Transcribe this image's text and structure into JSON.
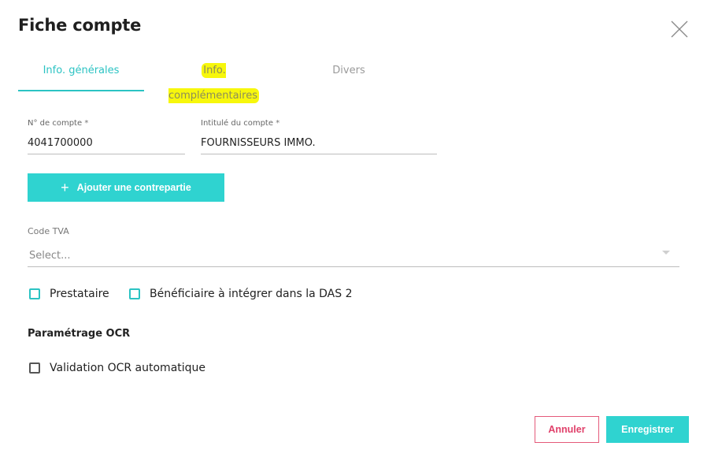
{
  "dialog": {
    "title": "Fiche compte"
  },
  "tabs": [
    {
      "label": "Info. générales"
    },
    {
      "label": "Info. complémentaires"
    },
    {
      "label": "Divers"
    }
  ],
  "account_number": {
    "label": "N° de compte",
    "required_mark": "*",
    "value": "4041700000"
  },
  "account_title": {
    "label": "Intitulé du compte",
    "required_mark": "*",
    "value": "FOURNISSEURS IMMO."
  },
  "add_counterpart": {
    "icon": "plus-icon",
    "plus": "+",
    "label": "Ajouter une contrepartie"
  },
  "vat_code": {
    "label": "Code TVA",
    "placeholder": "Select..."
  },
  "checkboxes": {
    "provider": {
      "label": "Prestataire",
      "checked": false
    },
    "beneficiary": {
      "label": "Bénéficiaire à intégrer dans la DAS 2",
      "checked": false
    }
  },
  "ocr_section": {
    "title": "Paramétrage OCR",
    "auto_validation": {
      "label": "Validation OCR automatique",
      "checked": false
    }
  },
  "footer": {
    "cancel_label": "Annuler",
    "save_label": "Enregistrer"
  },
  "colors": {
    "accent": "#2fd3d0",
    "cancel": "#e0406a",
    "highlight": "#f7f70c"
  }
}
